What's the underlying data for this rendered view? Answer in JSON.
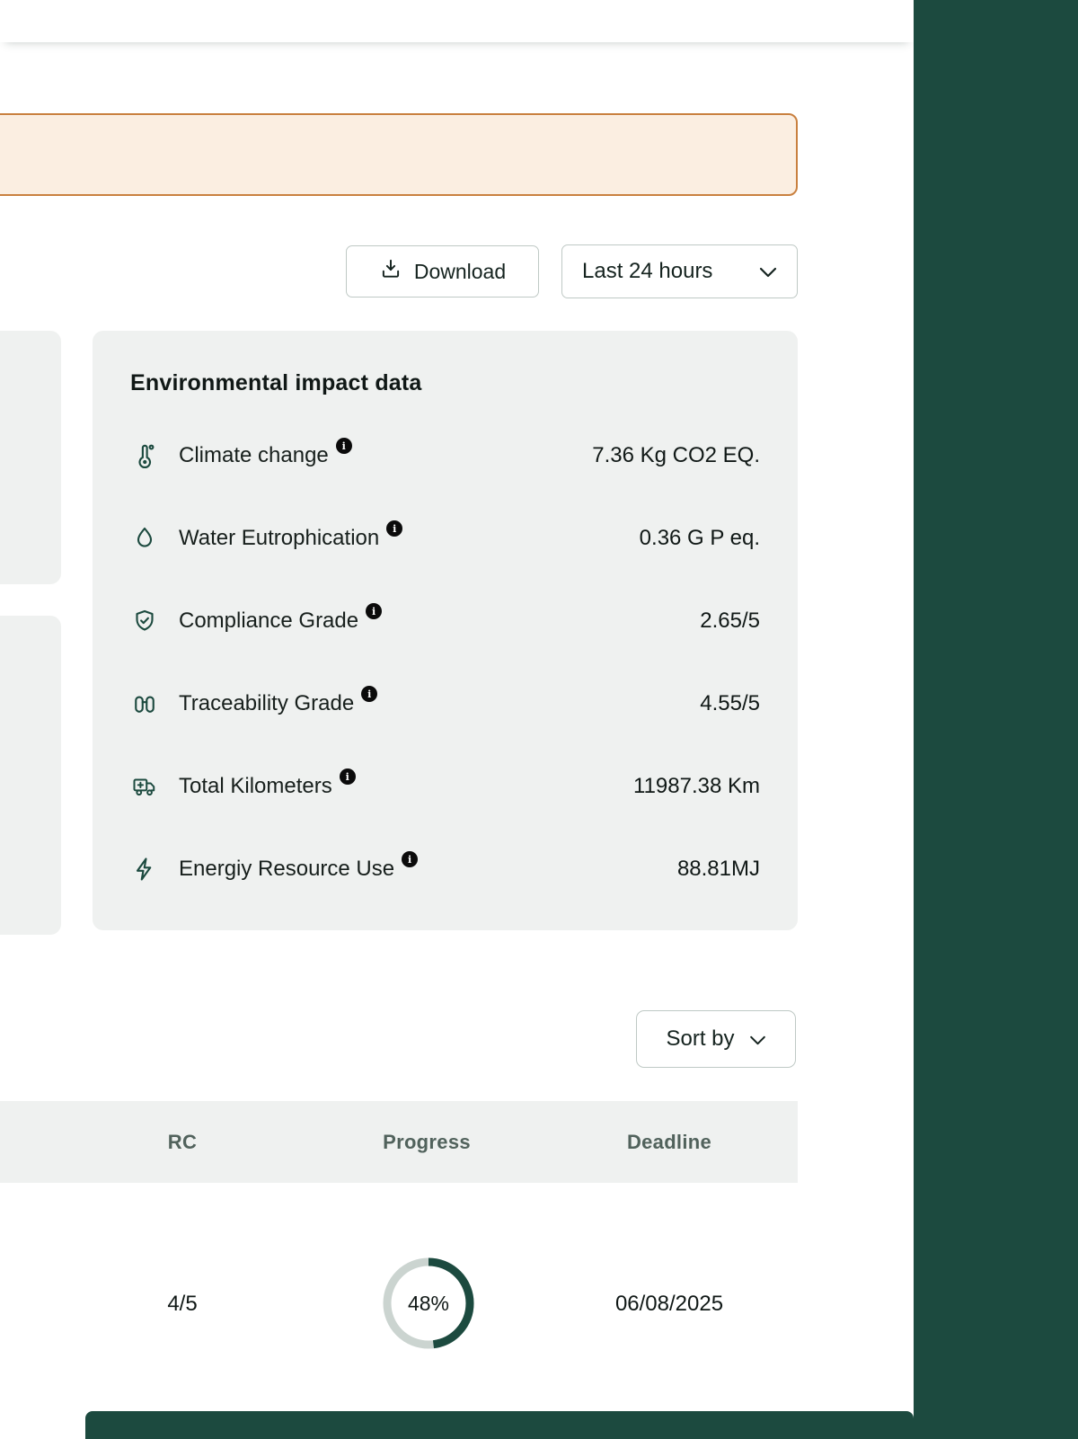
{
  "colors": {
    "brand_green": "#1C4A3F",
    "banner_bg": "#FBEEE1",
    "banner_border": "#C9803F",
    "card_bg": "#EFF1F0",
    "border_gray": "#BFC9C5",
    "text_dark": "#15231F",
    "muted_header": "#51625C",
    "ring_track": "#CBD4D0"
  },
  "toolbar": {
    "download_label": "Download",
    "time_range": {
      "selected": "Last 24 hours"
    }
  },
  "impact_panel": {
    "title": "Environmental impact data",
    "rows": [
      {
        "icon": "thermometer-icon",
        "label": "Climate change",
        "value": "7.36 Kg CO2 EQ."
      },
      {
        "icon": "water-drop-icon",
        "label": "Water Eutrophication",
        "value": "0.36 G P eq."
      },
      {
        "icon": "shield-check-icon",
        "label": "Compliance Grade",
        "value": "2.65/5"
      },
      {
        "icon": "binoculars-icon",
        "label": "Traceability Grade",
        "value": "4.55/5"
      },
      {
        "icon": "truck-icon",
        "label": "Total Kilometers",
        "value": "11987.38 Km"
      },
      {
        "icon": "lightning-icon",
        "label": "Energiy Resource Use",
        "value": "88.81MJ"
      }
    ]
  },
  "sort": {
    "label": "Sort by"
  },
  "table": {
    "columns": [
      "RC",
      "Progress",
      "Deadline"
    ],
    "rows": [
      {
        "rc": "4/5",
        "progress_percent": 48,
        "progress_label": "48%",
        "deadline": "06/08/2025"
      }
    ]
  }
}
